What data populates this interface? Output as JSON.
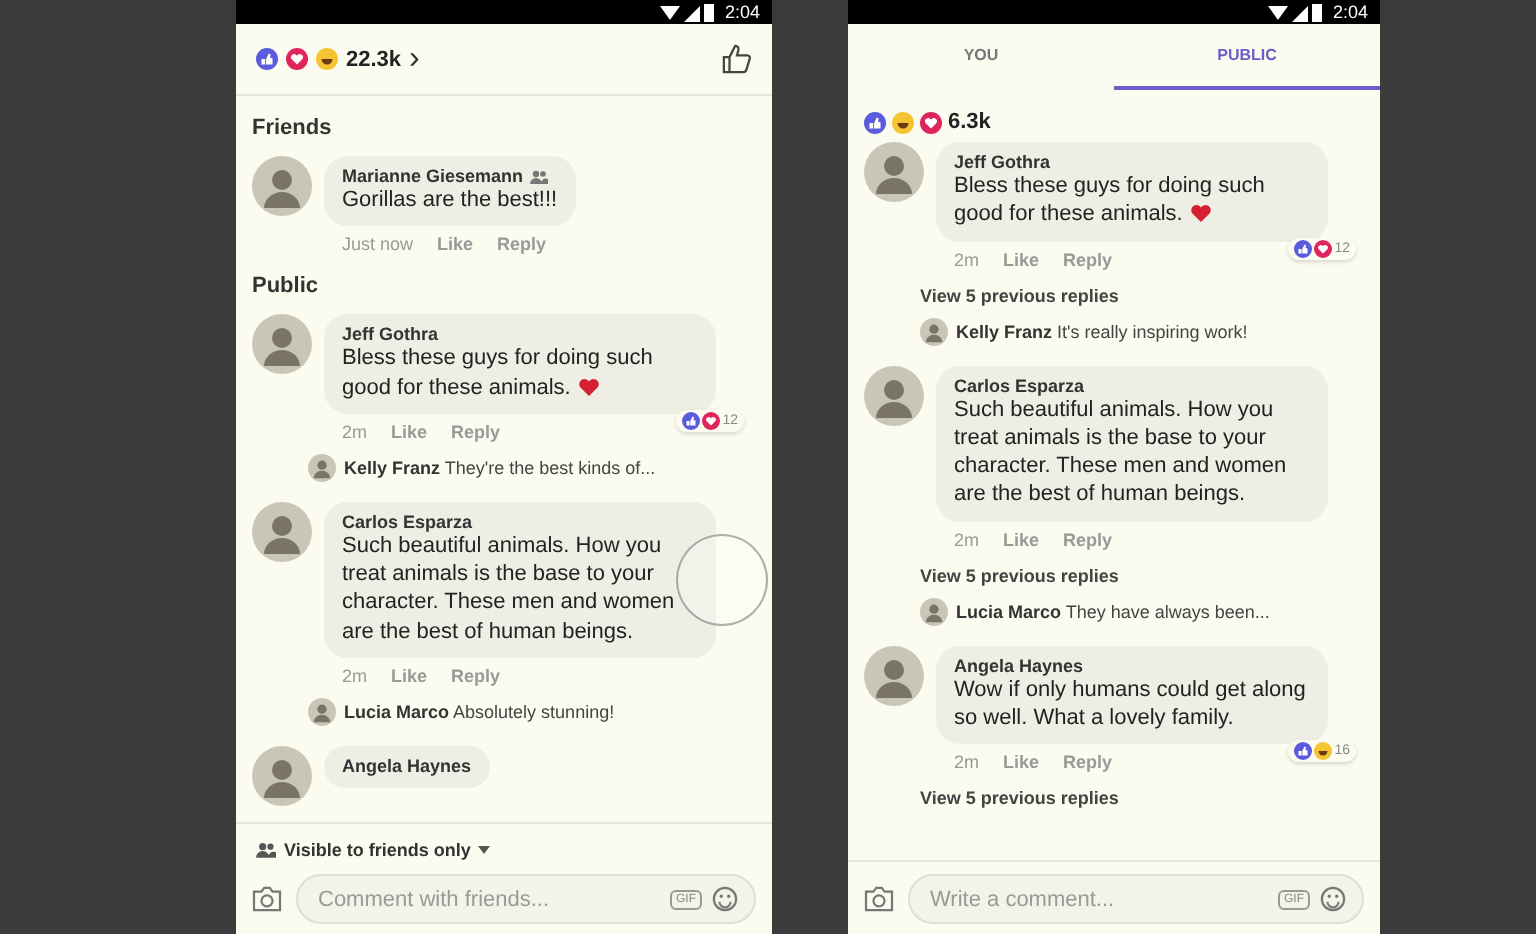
{
  "screens": [
    {
      "status_time": "2:04",
      "header": {
        "reactions": [
          {
            "kind": "like"
          },
          {
            "kind": "love"
          },
          {
            "kind": "haha"
          }
        ],
        "count": "22.3k",
        "chevron": "›"
      },
      "sections": [
        {
          "title": "Friends",
          "comments": [
            {
              "author": "Marianne Giesemann",
              "friend": true,
              "text": "Gorillas are the best!!!",
              "time": "Just now",
              "like": "Like",
              "reply": "Reply"
            }
          ]
        },
        {
          "title": "Public",
          "comments": [
            {
              "author": "Jeff Gothra",
              "text": "Bless these guys for doing such good for these animals.",
              "heart": true,
              "time": "2m",
              "like": "Like",
              "reply": "Reply",
              "badge": {
                "reactions": [
                  {
                    "kind": "like"
                  },
                  {
                    "kind": "love"
                  }
                ],
                "count": "12"
              },
              "reply_preview": {
                "author": "Kelly Franz",
                "text": "They're the best kinds of..."
              }
            },
            {
              "author": "Carlos Esparza",
              "text": "Such beautiful animals. How you treat animals is the base to your character. These men and women are the best of human beings.",
              "time": "2m",
              "like": "Like",
              "reply": "Reply",
              "reply_preview": {
                "author": "Lucia Marco",
                "text": "Absolutely stunning!"
              }
            },
            {
              "author": "Angela Haynes"
            }
          ]
        }
      ],
      "footer": {
        "visibility": "Visible to friends only",
        "placeholder": "Comment with friends...",
        "gif": "GIF"
      }
    },
    {
      "status_time": "2:04",
      "tabs": [
        {
          "label": "YOU",
          "selected": false
        },
        {
          "label": "PUBLIC",
          "selected": true
        }
      ],
      "header": {
        "reactions": [
          {
            "kind": "like"
          },
          {
            "kind": "haha"
          },
          {
            "kind": "love"
          }
        ],
        "count": "6.3k"
      },
      "sections": [
        {
          "comments": [
            {
              "author": "Jeff Gothra",
              "text": "Bless these guys for doing such good for these animals.",
              "heart": true,
              "time": "2m",
              "like": "Like",
              "reply": "Reply",
              "badge": {
                "reactions": [
                  {
                    "kind": "like"
                  },
                  {
                    "kind": "love"
                  }
                ],
                "count": "12"
              },
              "view_replies": "View 5 previous replies",
              "reply_preview": {
                "author": "Kelly Franz",
                "text": "It's really inspiring work!"
              }
            },
            {
              "author": "Carlos Esparza",
              "text": "Such beautiful animals. How you treat animals is the base to your character. These men and women are the best of human beings.",
              "time": "2m",
              "like": "Like",
              "reply": "Reply",
              "view_replies": "View 5 previous replies",
              "reply_preview": {
                "author": "Lucia Marco",
                "text": "They have always been..."
              }
            },
            {
              "author": "Angela Haynes",
              "text": "Wow if only humans could get along so well. What a lovely family.",
              "time": "2m",
              "like": "Like",
              "reply": "Reply",
              "badge": {
                "reactions": [
                  {
                    "kind": "like"
                  },
                  {
                    "kind": "haha"
                  }
                ],
                "count": "16"
              },
              "view_replies": "View 5 previous replies"
            }
          ]
        }
      ],
      "footer": {
        "placeholder": "Write a comment...",
        "gif": "GIF"
      }
    }
  ]
}
